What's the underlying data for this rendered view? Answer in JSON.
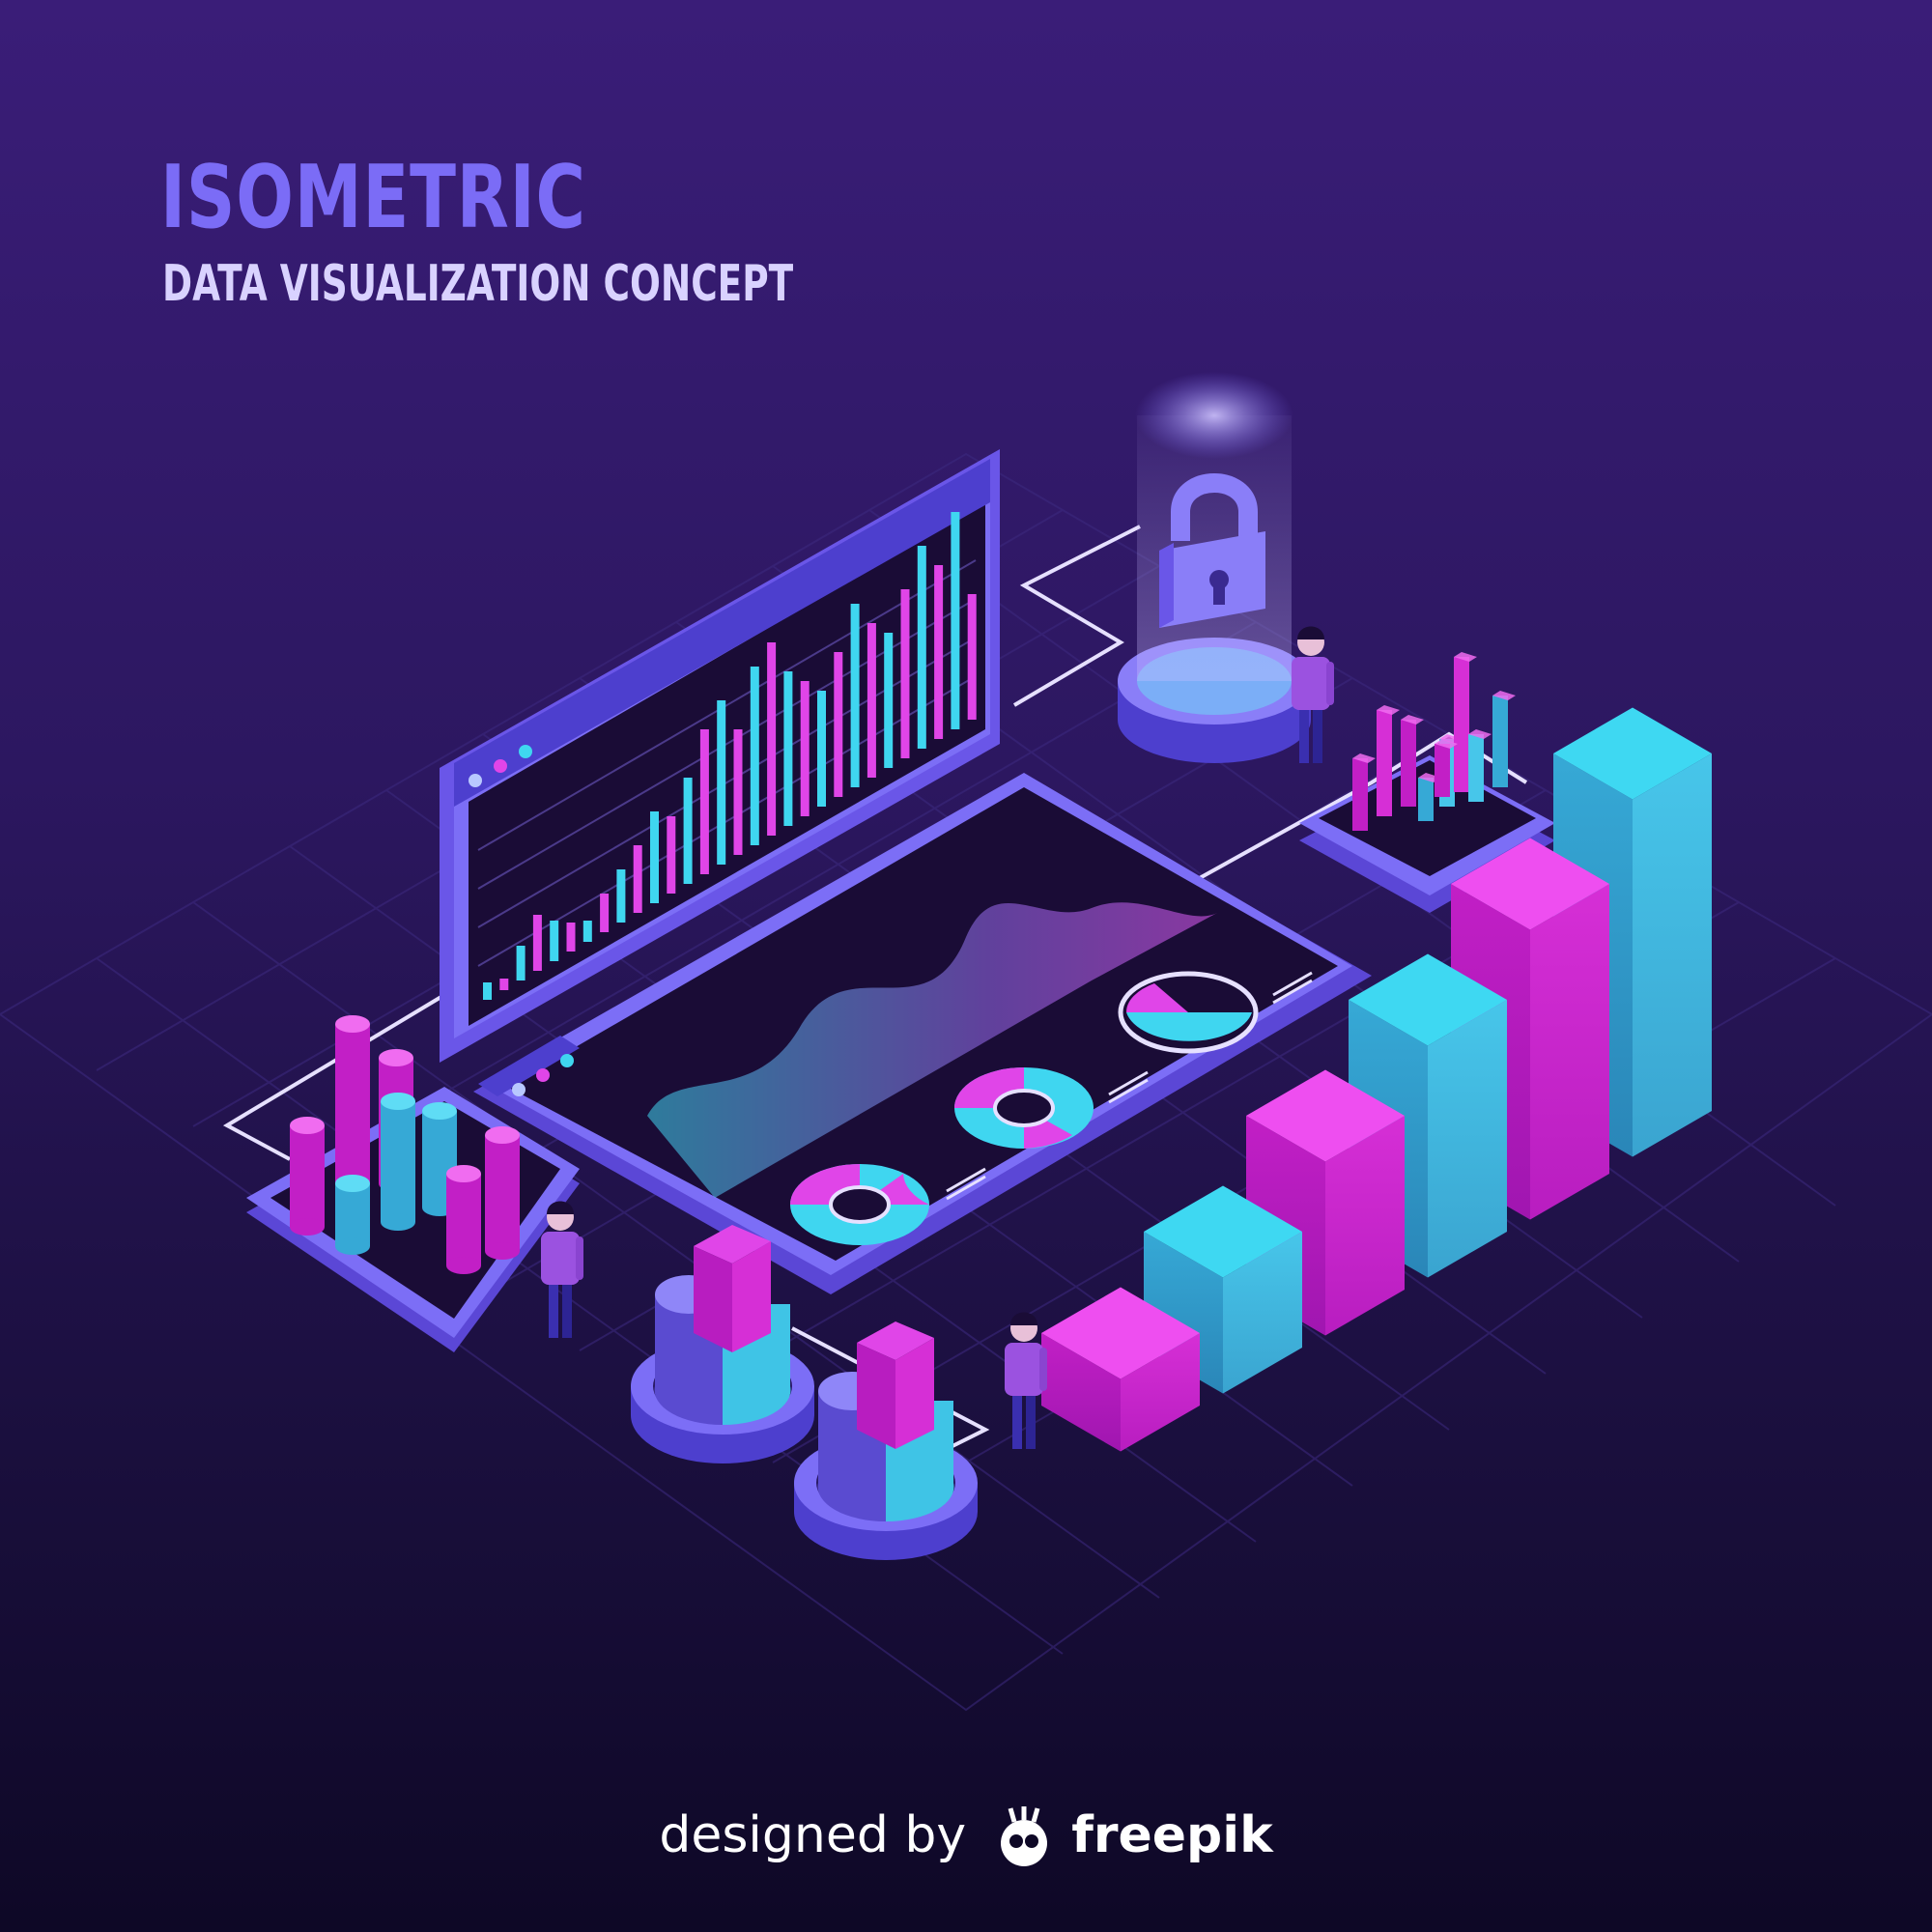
{
  "heading": {
    "title": "ISOMETRIC",
    "subtitle": "DATA VISUALIZATION CONCEPT"
  },
  "credit": {
    "prefix": "designed by",
    "brand": "freepik"
  },
  "colors": {
    "background_top": "#3a1d78",
    "background_bottom": "#0e0826",
    "accent_purple": "#7b6cf6",
    "accent_magenta": "#e03ee8",
    "accent_cyan": "#3fd6f0",
    "screen_dark": "#1a0c36"
  },
  "icons": [
    "padlock-icon",
    "freepik-logo-icon"
  ]
}
